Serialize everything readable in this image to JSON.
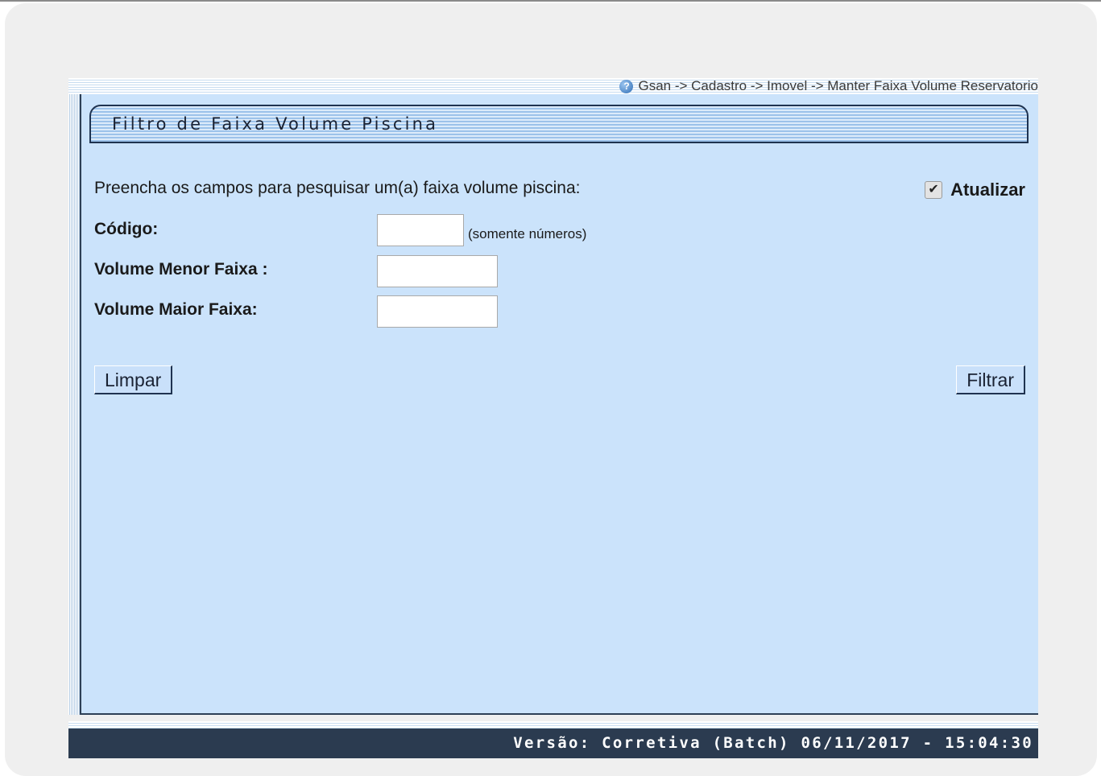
{
  "breadcrumb": {
    "text": "Gsan -> Cadastro -> Imovel -> Manter Faixa Volume Reservatorio",
    "help_icon": "help-icon"
  },
  "form": {
    "title": "Filtro de Faixa Volume Piscina",
    "instructions": "Preencha os campos para pesquisar um(a) faixa volume piscina:",
    "update_label": "Atualizar",
    "update_checked": true,
    "fields": [
      {
        "label": "Código:",
        "value": "",
        "hint": "(somente números)"
      },
      {
        "label": "Volume Menor Faixa :",
        "value": ""
      },
      {
        "label": "Volume Maior Faixa:",
        "value": ""
      }
    ],
    "clear_label": "Limpar",
    "filter_label": "Filtrar"
  },
  "footer": {
    "version": "Versão: Corretiva (Batch) 06/11/2017 - 15:04:30"
  },
  "colors": {
    "panel_bg": "#cbe3fb",
    "border_dark": "#1f3350",
    "footer_bg": "#2b3b50"
  }
}
